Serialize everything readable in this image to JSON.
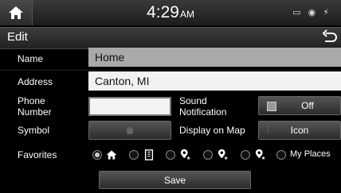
{
  "status": {
    "time": "4:29",
    "ampm": "AM",
    "icons": "▭ ◉ ⚡"
  },
  "header": {
    "title": "Edit"
  },
  "form": {
    "name_label": "Name",
    "name_value": "Home",
    "address_label": "Address",
    "address_value": "Canton, MI",
    "phone_label_1": "Phone",
    "phone_label_2": "Number",
    "phone_value": "",
    "sound_label_1": "Sound",
    "sound_label_2": "Notification",
    "sound_value": "Off",
    "symbol_label": "Symbol",
    "display_label": "Display on Map",
    "display_value": "Icon",
    "favorites_label": "Favorites",
    "my_places_label": "My Places"
  },
  "footer": {
    "save_label": "Save"
  }
}
